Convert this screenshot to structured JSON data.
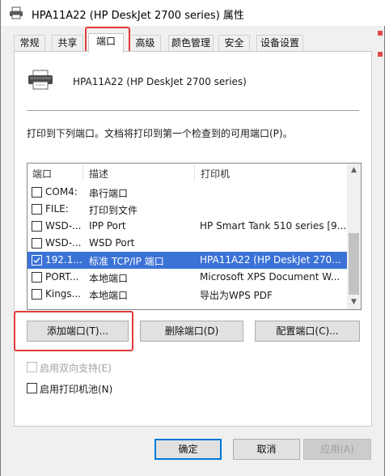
{
  "window": {
    "title": "HPA11A22 (HP DeskJet 2700 series) 属性"
  },
  "tabs": [
    {
      "label": "常规"
    },
    {
      "label": "共享"
    },
    {
      "label": "端口"
    },
    {
      "label": "高级"
    },
    {
      "label": "颜色管理"
    },
    {
      "label": "安全"
    },
    {
      "label": "设备设置"
    }
  ],
  "active_tab": "端口",
  "printer": {
    "name": "HPA11A22 (HP DeskJet 2700 series)",
    "icon": "printer-icon"
  },
  "description": "打印到下列端口。文档将打印到第一个检查到的可用端口(P)。",
  "port_list": {
    "columns": [
      "端口",
      "描述",
      "打印机"
    ],
    "rows": [
      {
        "port": "COM4:",
        "desc": "串行端口",
        "printer": "",
        "checked": false,
        "selected": false
      },
      {
        "port": "FILE:",
        "desc": "打印到文件",
        "printer": "",
        "checked": false,
        "selected": false
      },
      {
        "port": "WSD-...",
        "desc": "IPP Port",
        "printer": "HP Smart Tank 510 series [9...",
        "checked": false,
        "selected": false
      },
      {
        "port": "WSD-...",
        "desc": "WSD Port",
        "printer": "",
        "checked": false,
        "selected": false
      },
      {
        "port": "192.1...",
        "desc": "标准 TCP/IP 端口",
        "printer": "HPA11A22 (HP DeskJet 270...",
        "checked": true,
        "selected": true
      },
      {
        "port": "PORT...",
        "desc": "本地端口",
        "printer": "Microsoft XPS Document W...",
        "checked": false,
        "selected": false
      },
      {
        "port": "Kings...",
        "desc": "本地端口",
        "printer": "导出为WPS PDF",
        "checked": false,
        "selected": false
      }
    ]
  },
  "port_buttons": {
    "add": "添加端口(T)...",
    "delete": "删除端口(D)",
    "configure": "配置端口(C)..."
  },
  "options": {
    "bidirectional": {
      "label": "启用双向支持(E)",
      "checked": false,
      "enabled": false
    },
    "pooling": {
      "label": "启用打印机池(N)",
      "checked": false,
      "enabled": true
    }
  },
  "dialog_buttons": {
    "ok": "确定",
    "cancel": "取消",
    "apply": "应用(A)"
  },
  "colors": {
    "selection": "#3b72d6",
    "annotation": "#e23b3b",
    "focus_border": "#0078d7"
  }
}
